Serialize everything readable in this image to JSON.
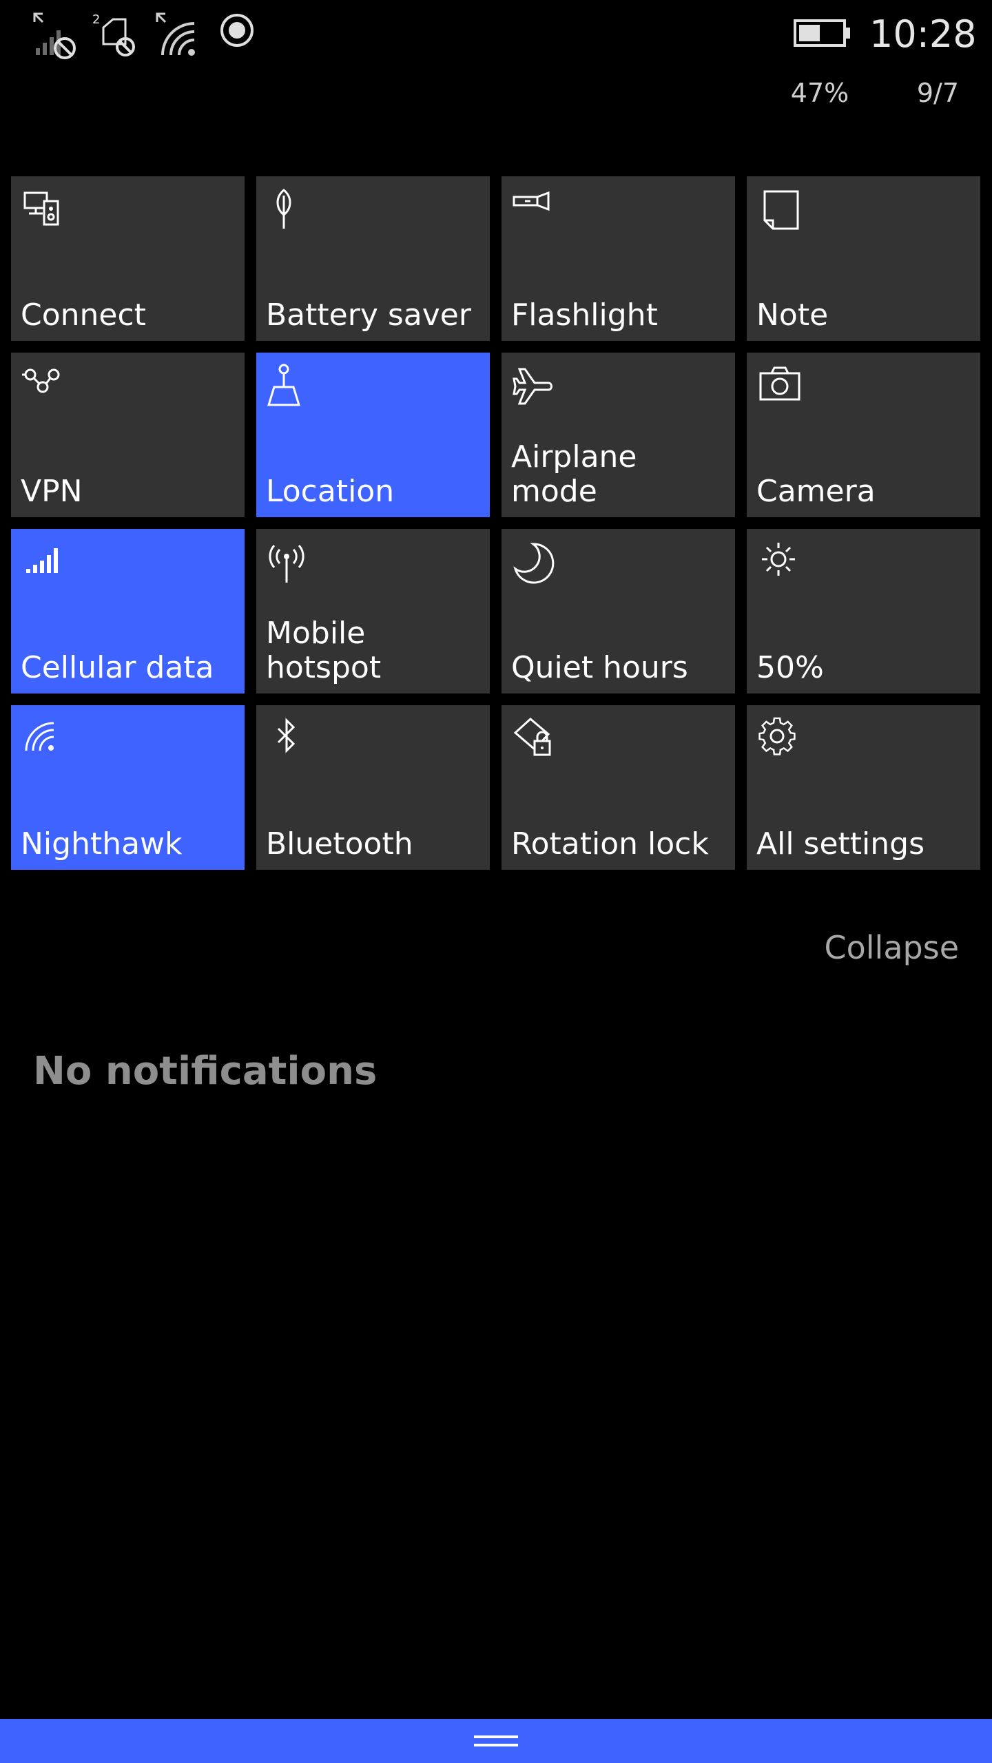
{
  "status_bar": {
    "icons": [
      "signal-no-sim-icon",
      "sim2-blocked-icon",
      "wifi-icon",
      "location-active-icon",
      "battery-icon"
    ],
    "time": "10:28",
    "battery_percent": "47%",
    "date": "9/7"
  },
  "quick_actions": [
    {
      "label": "Connect",
      "icon": "connect-icon",
      "active": false
    },
    {
      "label": "Battery saver",
      "icon": "battery-saver-icon",
      "active": false
    },
    {
      "label": "Flashlight",
      "icon": "flashlight-icon",
      "active": false
    },
    {
      "label": "Note",
      "icon": "note-icon",
      "active": false
    },
    {
      "label": "VPN",
      "icon": "vpn-icon",
      "active": false
    },
    {
      "label": "Location",
      "icon": "location-icon",
      "active": true
    },
    {
      "label": "Airplane mode",
      "icon": "airplane-icon",
      "active": false
    },
    {
      "label": "Camera",
      "icon": "camera-icon",
      "active": false
    },
    {
      "label": "Cellular data",
      "icon": "cellular-signal-icon",
      "active": true
    },
    {
      "label": "Mobile hotspot",
      "icon": "hotspot-icon",
      "active": false
    },
    {
      "label": "Quiet hours",
      "icon": "moon-icon",
      "active": false
    },
    {
      "label": "50%",
      "icon": "brightness-icon",
      "active": false
    },
    {
      "label": "Nighthawk",
      "icon": "wifi-icon",
      "active": true
    },
    {
      "label": "Bluetooth",
      "icon": "bluetooth-icon",
      "active": false
    },
    {
      "label": "Rotation lock",
      "icon": "rotation-lock-icon",
      "active": false
    },
    {
      "label": "All settings",
      "icon": "gear-icon",
      "active": false
    }
  ],
  "collapse_label": "Collapse",
  "notifications": {
    "empty_text": "No notifications"
  },
  "colors": {
    "accent": "#3e63ff",
    "tile_inactive": "#333333",
    "background": "#000000"
  }
}
